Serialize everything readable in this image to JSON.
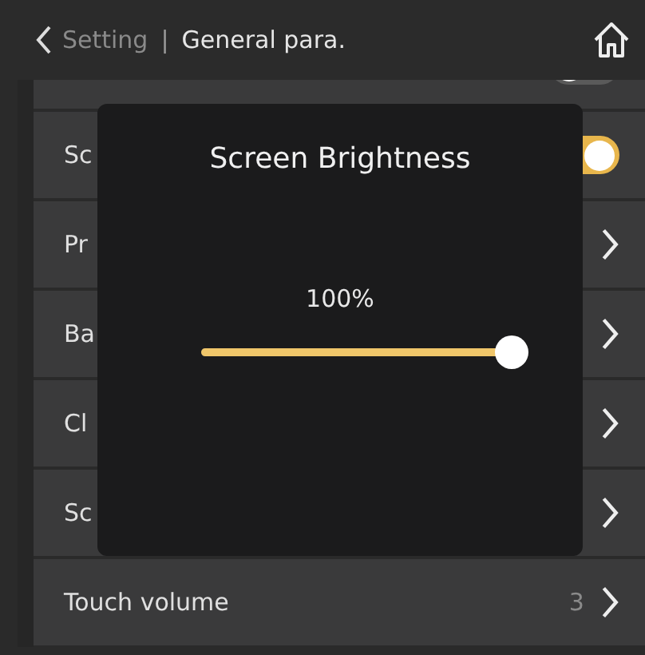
{
  "header": {
    "back": "Setting",
    "separator": "|",
    "title": "General para."
  },
  "rows": [
    {
      "kind": "toggle",
      "on": false
    },
    {
      "kind": "toggle",
      "label": "Sc",
      "on": true
    },
    {
      "kind": "link",
      "label": "Pr"
    },
    {
      "kind": "link",
      "label": "Ba"
    },
    {
      "kind": "link",
      "label": "Cl"
    },
    {
      "kind": "link",
      "label": "Sc"
    },
    {
      "kind": "link",
      "label": "Touch volume",
      "value": "3"
    }
  ],
  "dialog": {
    "title": "Screen Brightness",
    "reading": "100%",
    "level": 1
  }
}
